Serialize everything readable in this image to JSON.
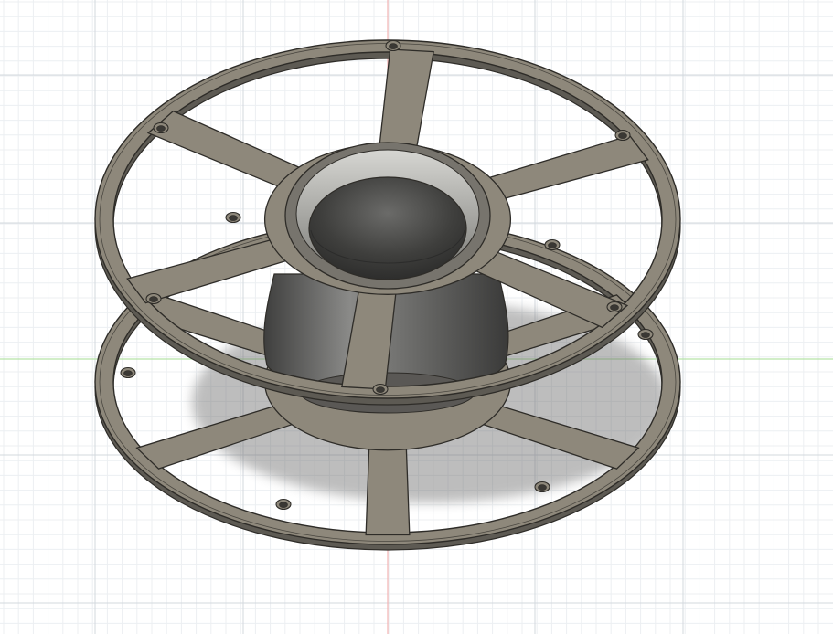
{
  "viewport": {
    "background": "#ffffff",
    "grid": {
      "minor_color": "#eceff2",
      "major_color": "#d3d8de",
      "x_axis_color": "#b6e3a8",
      "y_axis_color": "#f2b3b3"
    }
  },
  "model": {
    "name": "filament-spool",
    "body_color": "#8e887b",
    "edge_color": "#2e2c28",
    "hub_interior_color": "#4a4a48",
    "spoke_count": 6,
    "mounting_holes_per_flange": 6
  }
}
